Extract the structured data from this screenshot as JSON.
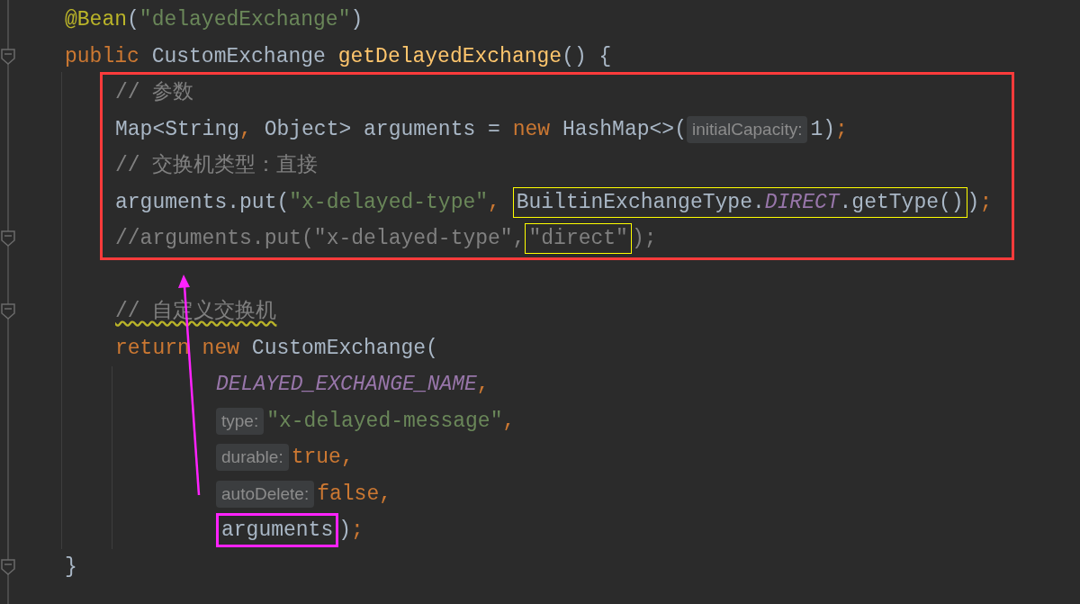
{
  "lines": [
    {
      "kind": "line",
      "fold": false,
      "tokens": [
        {
          "kind": "annotation",
          "text": "@Bean"
        },
        {
          "kind": "plain",
          "text": "("
        },
        {
          "kind": "string",
          "text": "\"delayedExchange\""
        },
        {
          "kind": "plain",
          "text": ")"
        }
      ]
    },
    {
      "kind": "line",
      "fold": true,
      "tokens": [
        {
          "kind": "keyword",
          "text": "public "
        },
        {
          "kind": "plain",
          "text": "CustomExchange "
        },
        {
          "kind": "method",
          "text": "getDelayedExchange"
        },
        {
          "kind": "plain",
          "text": "() {"
        }
      ],
      "body": {
        "kind": "block",
        "items": [
          {
            "kind": "frame",
            "color": "#ff3b3b",
            "lines": [
              {
                "kind": "line",
                "fold": false,
                "tokens": [
                  {
                    "kind": "comment",
                    "text": "// 参数"
                  }
                ]
              },
              {
                "kind": "line",
                "fold": false,
                "tokens": [
                  {
                    "kind": "plain",
                    "text": "Map<String"
                  },
                  {
                    "kind": "punct",
                    "text": ", "
                  },
                  {
                    "kind": "plain",
                    "text": "Object> arguments = "
                  },
                  {
                    "kind": "keyword",
                    "text": "new "
                  },
                  {
                    "kind": "plain",
                    "text": "HashMap<>("
                  },
                  {
                    "kind": "hint",
                    "text": "initialCapacity:"
                  },
                  {
                    "kind": "plain",
                    "text": "1)"
                  },
                  {
                    "kind": "punct",
                    "text": ";"
                  }
                ]
              },
              {
                "kind": "line",
                "fold": false,
                "tokens": [
                  {
                    "kind": "comment",
                    "text": "// 交换机类型：直接"
                  }
                ]
              },
              {
                "kind": "line",
                "fold": false,
                "tokens": [
                  {
                    "kind": "plain",
                    "text": "arguments.put("
                  },
                  {
                    "kind": "string",
                    "text": "\"x-delayed-type\""
                  },
                  {
                    "kind": "punct",
                    "text": ", "
                  },
                  {
                    "kind": "group",
                    "color": "#ffff00",
                    "tokens": [
                      {
                        "kind": "plain",
                        "text": "BuiltinExchangeType."
                      },
                      {
                        "kind": "constant",
                        "text": "DIRECT"
                      },
                      {
                        "kind": "plain",
                        "text": ".getType()"
                      }
                    ]
                  },
                  {
                    "kind": "plain",
                    "text": ")"
                  },
                  {
                    "kind": "punct",
                    "text": ";"
                  }
                ]
              },
              {
                "kind": "line",
                "fold": true,
                "tokens": [
                  {
                    "kind": "comment",
                    "text": "//arguments.put(\"x-delayed-type\","
                  },
                  {
                    "kind": "group",
                    "color": "#ffff00",
                    "tokens": [
                      {
                        "kind": "comment",
                        "text": "\"direct\""
                      }
                    ]
                  },
                  {
                    "kind": "comment",
                    "text": ");"
                  }
                ]
              }
            ]
          },
          {
            "kind": "blank"
          },
          {
            "kind": "line",
            "fold": true,
            "tokens": [
              {
                "kind": "comment",
                "text": "// 自定义交换机",
                "wavy": true
              }
            ]
          },
          {
            "kind": "line",
            "fold": false,
            "tokens": [
              {
                "kind": "keyword",
                "text": "return new "
              },
              {
                "kind": "plain",
                "text": "CustomExchange("
              }
            ],
            "body": {
              "kind": "continuation",
              "items": [
                {
                  "kind": "line",
                  "fold": false,
                  "tokens": [
                    {
                      "kind": "constant",
                      "text": "DELAYED_EXCHANGE_NAME"
                    },
                    {
                      "kind": "punct",
                      "text": ","
                    }
                  ]
                },
                {
                  "kind": "line",
                  "fold": false,
                  "tokens": [
                    {
                      "kind": "hint",
                      "text": "type:"
                    },
                    {
                      "kind": "string",
                      "text": "\"x-delayed-message\""
                    },
                    {
                      "kind": "punct",
                      "text": ","
                    }
                  ]
                },
                {
                  "kind": "line",
                  "fold": false,
                  "tokens": [
                    {
                      "kind": "hint",
                      "text": "durable:"
                    },
                    {
                      "kind": "keyword",
                      "text": "true"
                    },
                    {
                      "kind": "punct",
                      "text": ","
                    }
                  ]
                },
                {
                  "kind": "line",
                  "fold": false,
                  "tokens": [
                    {
                      "kind": "hint",
                      "text": "autoDelete:"
                    },
                    {
                      "kind": "keyword",
                      "text": "false"
                    },
                    {
                      "kind": "punct",
                      "text": ","
                    }
                  ]
                },
                {
                  "kind": "line",
                  "fold": false,
                  "tokens": [
                    {
                      "kind": "group",
                      "color": "#ff22ff",
                      "arrow": true,
                      "tokens": [
                        {
                          "kind": "plain",
                          "text": "arguments"
                        }
                      ]
                    },
                    {
                      "kind": "plain",
                      "text": ")"
                    },
                    {
                      "kind": "punct",
                      "text": ";"
                    }
                  ]
                }
              ]
            }
          }
        ]
      }
    },
    {
      "kind": "line",
      "fold": true,
      "tokens": [
        {
          "kind": "plain",
          "text": "}"
        }
      ]
    }
  ]
}
